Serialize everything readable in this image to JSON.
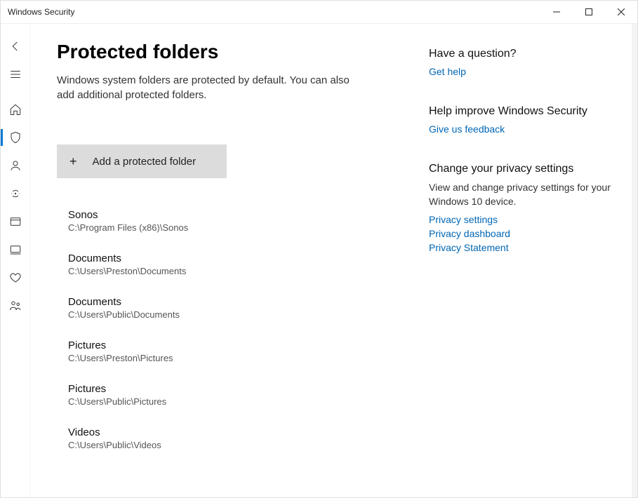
{
  "window": {
    "title": "Windows Security"
  },
  "page": {
    "heading": "Protected folders",
    "description": "Windows system folders are protected by default. You can also add additional protected folders.",
    "add_button": "Add a protected folder"
  },
  "folders": [
    {
      "name": "Sonos",
      "path": "C:\\Program Files (x86)\\Sonos"
    },
    {
      "name": "Documents",
      "path": "C:\\Users\\Preston\\Documents"
    },
    {
      "name": "Documents",
      "path": "C:\\Users\\Public\\Documents"
    },
    {
      "name": "Pictures",
      "path": "C:\\Users\\Preston\\Pictures"
    },
    {
      "name": "Pictures",
      "path": "C:\\Users\\Public\\Pictures"
    },
    {
      "name": "Videos",
      "path": "C:\\Users\\Public\\Videos"
    }
  ],
  "sidebar": {
    "question": {
      "heading": "Have a question?",
      "link": "Get help"
    },
    "improve": {
      "heading": "Help improve Windows Security",
      "link": "Give us feedback"
    },
    "privacy": {
      "heading": "Change your privacy settings",
      "text": "View and change privacy settings for your Windows 10 device.",
      "links": [
        "Privacy settings",
        "Privacy dashboard",
        "Privacy Statement"
      ]
    }
  }
}
